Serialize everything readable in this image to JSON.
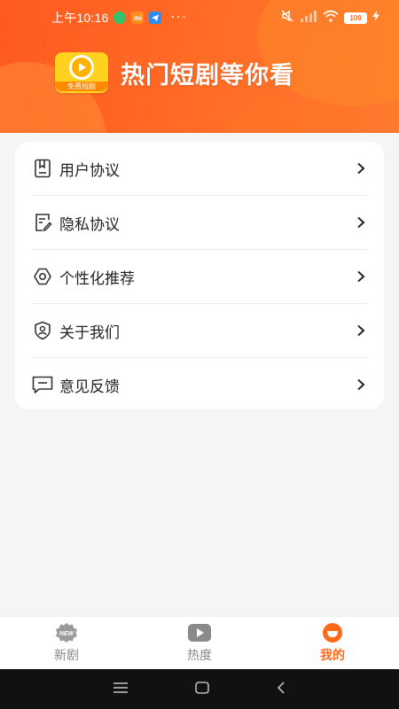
{
  "status_bar": {
    "time": "上午10:16",
    "more": "···",
    "battery": "100",
    "mini_badge_mi": "mi"
  },
  "header": {
    "logo_text": "免费短剧",
    "title": "热门短剧等你看"
  },
  "menu": {
    "items": [
      {
        "label": "用户协议",
        "icon": "book-icon"
      },
      {
        "label": "隐私协议",
        "icon": "document-edit-icon"
      },
      {
        "label": "个性化推荐",
        "icon": "gear-icon"
      },
      {
        "label": "关于我们",
        "icon": "user-shield-icon"
      },
      {
        "label": "意见反馈",
        "icon": "message-icon"
      }
    ]
  },
  "bottom_nav": {
    "items": [
      {
        "label": "新剧",
        "icon": "new-badge-icon",
        "active": false
      },
      {
        "label": "热度",
        "icon": "play-icon",
        "active": false
      },
      {
        "label": "我的",
        "icon": "profile-icon",
        "active": true
      }
    ]
  },
  "colors": {
    "accent": "#ff6a1a",
    "header_gradient_start": "#ff5a1f",
    "header_gradient_end": "#ff7a2e",
    "logo_yellow": "#ffd21f"
  }
}
